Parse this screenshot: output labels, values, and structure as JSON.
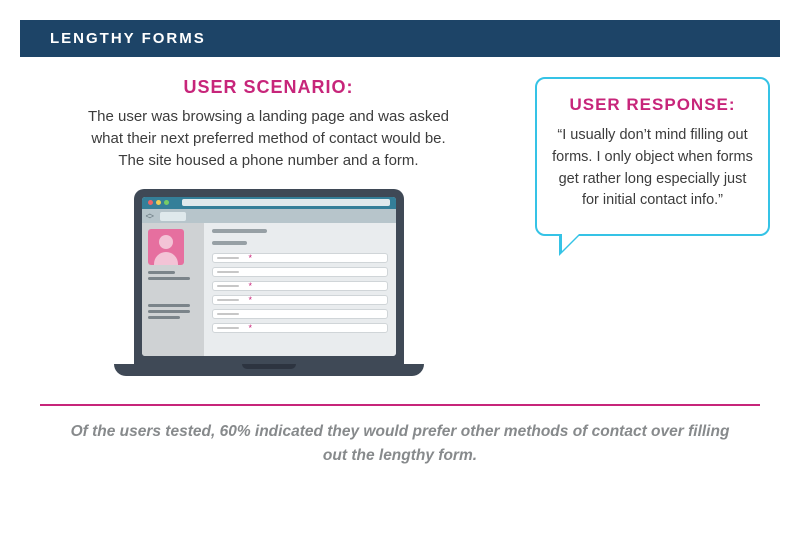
{
  "banner": "LENGTHY FORMS",
  "scenario": {
    "heading": "USER SCENARIO:",
    "body": "The user was browsing a landing page and was asked what their next preferred method of contact would be. The site housed a phone number and a form."
  },
  "response": {
    "heading": "USER RESPONSE:",
    "body": "“I usually don’t mind filling out forms. I only object when forms get rather long especially just for initial contact info.”"
  },
  "footer": "Of the users tested, 60% indicated they would prefer other methods of contact over filling out the lengthy form."
}
